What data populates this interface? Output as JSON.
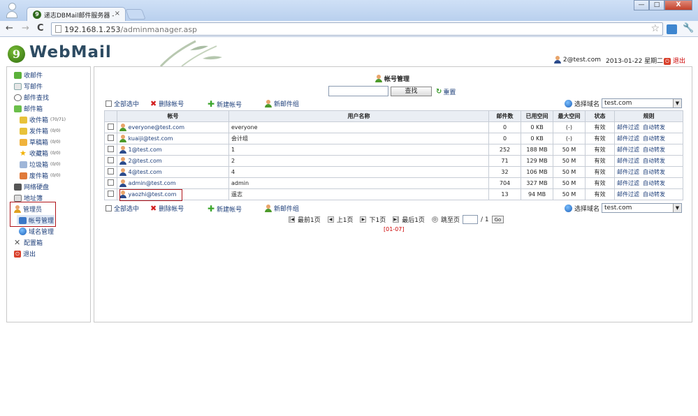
{
  "browser": {
    "tab_title": "递志DBMail邮件服务器 - \\",
    "tab_close": "×",
    "url_host": "192.168.1.253",
    "url_path": "/adminmanager.asp",
    "back": "←",
    "forward": "→",
    "reload": "C",
    "star": "☆",
    "wrench": "🔧",
    "win_min": "—",
    "win_max": "□",
    "win_close": "X"
  },
  "header": {
    "logo": "WebMail",
    "logo_mark": "9",
    "user": "2@test.com",
    "date": "2013-01-22 星期二",
    "exit": "退出"
  },
  "sidebar": {
    "items": [
      {
        "label": "收邮件"
      },
      {
        "label": "写邮件"
      },
      {
        "label": "邮件查找"
      },
      {
        "label": "邮件箱"
      },
      {
        "label": "收件箱",
        "count": "(70/71)"
      },
      {
        "label": "发件箱",
        "count": "(0/0)"
      },
      {
        "label": "草稿箱",
        "count": "(0/0)"
      },
      {
        "label": "收藏箱",
        "count": "(0/0)"
      },
      {
        "label": "垃圾箱",
        "count": "(0/0)"
      },
      {
        "label": "废件箱",
        "count": "(0/0)"
      },
      {
        "label": "网络硬盘"
      },
      {
        "label": "地址簿"
      },
      {
        "label": "管理员"
      },
      {
        "label": "帐号管理"
      },
      {
        "label": "域名管理"
      },
      {
        "label": "配置箱"
      },
      {
        "label": "退出"
      }
    ]
  },
  "main": {
    "title": "帐号管理",
    "search_button": "查找",
    "reset": "重置",
    "select_all": "全部选中",
    "delete_account": "删除帐号",
    "new_account": "新建帐号",
    "new_group": "新邮件组",
    "choose_domain": "选择域名",
    "domain_value": "test.com",
    "columns": [
      "帐号",
      "用户名称",
      "邮件数",
      "已用空间",
      "最大空间",
      "状态",
      "规则"
    ],
    "rows": [
      {
        "account": "everyone@test.com",
        "name": "everyone",
        "mails": "0",
        "used": "0 KB",
        "max": "(-)",
        "status": "有效",
        "icon": "green"
      },
      {
        "account": "kuaiji@test.com",
        "name": "会计组",
        "mails": "0",
        "used": "0 KB",
        "max": "(-)",
        "status": "有效",
        "icon": "green"
      },
      {
        "account": "1@test.com",
        "name": "1",
        "mails": "252",
        "used": "188 MB",
        "max": "50 M",
        "status": "有效",
        "icon": "dark"
      },
      {
        "account": "2@test.com",
        "name": "2",
        "mails": "71",
        "used": "129 MB",
        "max": "50 M",
        "status": "有效",
        "icon": "dark"
      },
      {
        "account": "4@test.com",
        "name": "4",
        "mails": "32",
        "used": "106 MB",
        "max": "50 M",
        "status": "有效",
        "icon": "dark"
      },
      {
        "account": "admin@test.com",
        "name": "admin",
        "mails": "704",
        "used": "327 MB",
        "max": "50 M",
        "status": "有效",
        "icon": "dark"
      },
      {
        "account": "yaozhi@test.com",
        "name": "遥志",
        "mails": "13",
        "used": "94 MB",
        "max": "50 M",
        "status": "有效",
        "icon": "dark"
      }
    ],
    "rule_filter": "邮件过滤",
    "rule_forward": "自动转发",
    "pager": {
      "first": "最前1页",
      "prev": "上1页",
      "next": "下1页",
      "last": "最后1页",
      "goto": "跳至页",
      "total": "/ 1",
      "go": "Go",
      "code": "[01-07]"
    }
  }
}
